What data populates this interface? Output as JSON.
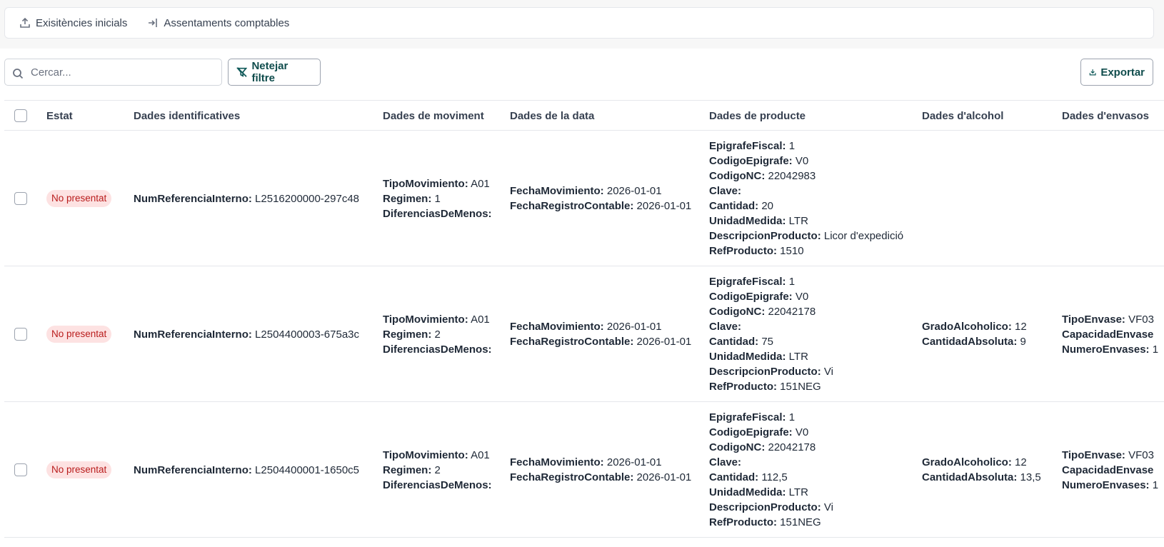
{
  "toolbar": {
    "initial_stock_label": "Exisitències inicials",
    "accounting_entries_label": "Assentaments comptables"
  },
  "filters": {
    "search_placeholder": "Cercar...",
    "clear_filter_label": "Netejar filtre",
    "export_label": "Exportar"
  },
  "table": {
    "columns": [
      "Estat",
      "Dades identificatives",
      "Dades de moviment",
      "Dades de la data",
      "Dades de producte",
      "Dades d'alcohol",
      "Dades d'envasos"
    ],
    "rows": [
      {
        "status": "No presentat",
        "id": [
          {
            "k": "NumReferenciaInterno:",
            "v": "L2516200000-297c48"
          }
        ],
        "movement": [
          {
            "k": "TipoMovimiento:",
            "v": "A01"
          },
          {
            "k": "Regimen:",
            "v": "1"
          },
          {
            "k": "DiferenciasDeMenos:",
            "v": ""
          }
        ],
        "date": [
          {
            "k": "FechaMovimiento:",
            "v": "2026-01-01"
          },
          {
            "k": "FechaRegistroContable:",
            "v": "2026-01-01"
          }
        ],
        "product": [
          {
            "k": "EpigrafeFiscal:",
            "v": "1"
          },
          {
            "k": "CodigoEpigrafe:",
            "v": "V0"
          },
          {
            "k": "CodigoNC:",
            "v": "22042983"
          },
          {
            "k": "Clave:",
            "v": ""
          },
          {
            "k": "Cantidad:",
            "v": "20"
          },
          {
            "k": "UnidadMedida:",
            "v": "LTR"
          },
          {
            "k": "DescripcionProducto:",
            "v": "Licor d'expedició"
          },
          {
            "k": "RefProducto:",
            "v": "1510"
          }
        ],
        "alcohol": [],
        "packaging": []
      },
      {
        "status": "No presentat",
        "id": [
          {
            "k": "NumReferenciaInterno:",
            "v": "L2504400003-675a3c"
          }
        ],
        "movement": [
          {
            "k": "TipoMovimiento:",
            "v": "A01"
          },
          {
            "k": "Regimen:",
            "v": "2"
          },
          {
            "k": "DiferenciasDeMenos:",
            "v": ""
          }
        ],
        "date": [
          {
            "k": "FechaMovimiento:",
            "v": "2026-01-01"
          },
          {
            "k": "FechaRegistroContable:",
            "v": "2026-01-01"
          }
        ],
        "product": [
          {
            "k": "EpigrafeFiscal:",
            "v": "1"
          },
          {
            "k": "CodigoEpigrafe:",
            "v": "V0"
          },
          {
            "k": "CodigoNC:",
            "v": "22042178"
          },
          {
            "k": "Clave:",
            "v": ""
          },
          {
            "k": "Cantidad:",
            "v": "75"
          },
          {
            "k": "UnidadMedida:",
            "v": "LTR"
          },
          {
            "k": "DescripcionProducto:",
            "v": "Vi"
          },
          {
            "k": "RefProducto:",
            "v": "151NEG"
          }
        ],
        "alcohol": [
          {
            "k": "GradoAlcoholico:",
            "v": "12"
          },
          {
            "k": "CantidadAbsoluta:",
            "v": "9"
          }
        ],
        "packaging": [
          {
            "k": "TipoEnvase:",
            "v": "VF03"
          },
          {
            "k": "CapacidadEnvase",
            "v": ""
          },
          {
            "k": "NumeroEnvases:",
            "v": "1"
          }
        ]
      },
      {
        "status": "No presentat",
        "id": [
          {
            "k": "NumReferenciaInterno:",
            "v": "L2504400001-1650c5"
          }
        ],
        "movement": [
          {
            "k": "TipoMovimiento:",
            "v": "A01"
          },
          {
            "k": "Regimen:",
            "v": "2"
          },
          {
            "k": "DiferenciasDeMenos:",
            "v": ""
          }
        ],
        "date": [
          {
            "k": "FechaMovimiento:",
            "v": "2026-01-01"
          },
          {
            "k": "FechaRegistroContable:",
            "v": "2026-01-01"
          }
        ],
        "product": [
          {
            "k": "EpigrafeFiscal:",
            "v": "1"
          },
          {
            "k": "CodigoEpigrafe:",
            "v": "V0"
          },
          {
            "k": "CodigoNC:",
            "v": "22042178"
          },
          {
            "k": "Clave:",
            "v": ""
          },
          {
            "k": "Cantidad:",
            "v": "112,5"
          },
          {
            "k": "UnidadMedida:",
            "v": "LTR"
          },
          {
            "k": "DescripcionProducto:",
            "v": "Vi"
          },
          {
            "k": "RefProducto:",
            "v": "151NEG"
          }
        ],
        "alcohol": [
          {
            "k": "GradoAlcoholico:",
            "v": "12"
          },
          {
            "k": "CantidadAbsoluta:",
            "v": "13,5"
          }
        ],
        "packaging": [
          {
            "k": "TipoEnvase:",
            "v": "VF03"
          },
          {
            "k": "CapacidadEnvase",
            "v": ""
          },
          {
            "k": "NumeroEnvases:",
            "v": "1"
          }
        ]
      }
    ]
  },
  "colors": {
    "accent": "#0f4c4c",
    "badge_bg": "#fde2e2",
    "badge_text": "#b91c1c"
  }
}
